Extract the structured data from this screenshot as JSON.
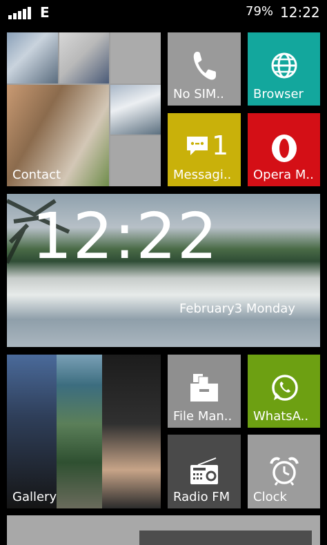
{
  "status_bar": {
    "network_type": "E",
    "battery": "79%",
    "time": "12:22"
  },
  "tiles": {
    "contact": {
      "label": "Contact"
    },
    "phone": {
      "label": "No SIM.."
    },
    "browser": {
      "label": "Browser"
    },
    "messaging": {
      "label": "Messagi..",
      "badge": "1"
    },
    "opera": {
      "label": "Opera M.."
    },
    "clock_widget": {
      "time": "12:22",
      "date": "February3 Monday"
    },
    "gallery": {
      "label": "Gallery"
    },
    "file_manager": {
      "label": "File Man.."
    },
    "whatsapp": {
      "label": "WhatsA.."
    },
    "radio": {
      "label": "Radio FM"
    },
    "clock": {
      "label": "Clock"
    }
  },
  "colors": {
    "phone": "#9a9a9a",
    "browser": "#13a79d",
    "messaging": "#c9b10a",
    "opera": "#d40f16",
    "file_manager": "#8f8f8f",
    "whatsapp": "#6da012",
    "radio": "#4a4a4a",
    "clock": "#9c9c9c",
    "bottom_bar": "#a8a8a8",
    "bottom_bar_inner": "#4d4d4d"
  }
}
